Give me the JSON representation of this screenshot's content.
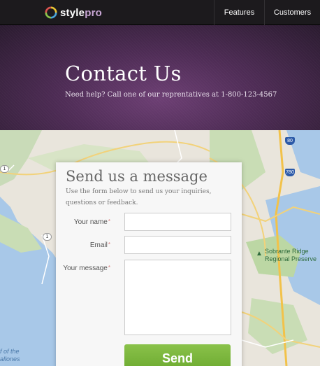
{
  "nav": {
    "logo_prefix": "style",
    "logo_suffix": "pro",
    "logo_icon": "swirl-logo-icon",
    "items": [
      {
        "label": "Features"
      },
      {
        "label": "Customers"
      }
    ]
  },
  "hero": {
    "title": "Contact Us",
    "subtitle": "Need help? Call one of our reprentatives at 1-800-123-4567"
  },
  "map": {
    "park_label_line1": "Sobrante Ridge",
    "park_label_line2": "Regional Preserve",
    "ocean_label_line1": "f of the",
    "ocean_label_line2": "allones",
    "route_1a": "1",
    "route_1b": "1",
    "interstate_80": "80",
    "interstate_780": "780"
  },
  "form": {
    "heading": "Send us a message",
    "intro": "Use the form below to send us your inquiries, questions or feedback.",
    "name_label": "Your name",
    "email_label": "Email",
    "message_label": "Your message",
    "required_mark": "*",
    "name_value": "",
    "email_value": "",
    "message_value": "",
    "send_label": "Send"
  },
  "colors": {
    "accent_purple": "#5a3462",
    "send_green": "#7ab83c",
    "nav_bg": "#1c1a1d"
  }
}
